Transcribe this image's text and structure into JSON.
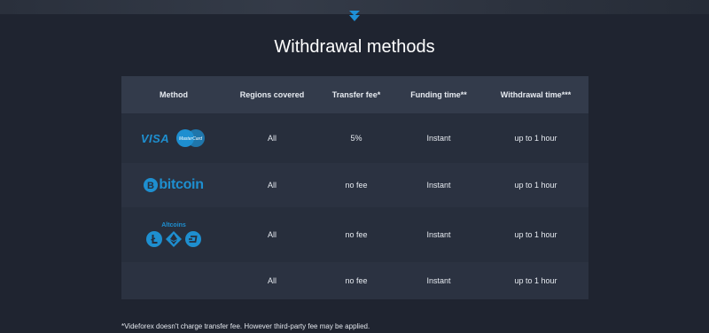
{
  "page": {
    "title": "Withdrawal methods",
    "footnote": "*Videforex doesn't charge transfer fee. However third-party fee may be applied."
  },
  "table": {
    "headers": [
      "Method",
      "Regions covered",
      "Transfer fee*",
      "Funding time**",
      "Withdrawal time***"
    ],
    "rows": [
      {
        "method": {
          "visa": "VISA",
          "mastercard": "MasterCard"
        },
        "regions": "All",
        "fee": "5%",
        "funding": "Instant",
        "withdrawal": "up to 1 hour"
      },
      {
        "method": {
          "bitcoin": "bitcoin"
        },
        "regions": "All",
        "fee": "no fee",
        "funding": "Instant",
        "withdrawal": "up to 1 hour"
      },
      {
        "method": {
          "altcoins": "Altcoins"
        },
        "regions": "All",
        "fee": "no fee",
        "funding": "Instant",
        "withdrawal": "up to 1 hour"
      },
      {
        "method": {},
        "regions": "All",
        "fee": "no fee",
        "funding": "Instant",
        "withdrawal": "up to 1 hour"
      }
    ]
  },
  "icons": {
    "chevron": "double-chevron-down-icon",
    "bitcoin": "bitcoin-icon",
    "litecoin": "litecoin-icon",
    "ethereum": "ethereum-icon",
    "dash": "dash-icon"
  },
  "colors": {
    "background": "#1f2430",
    "accent": "#1e8fd0",
    "header_row": "#333b4b"
  }
}
